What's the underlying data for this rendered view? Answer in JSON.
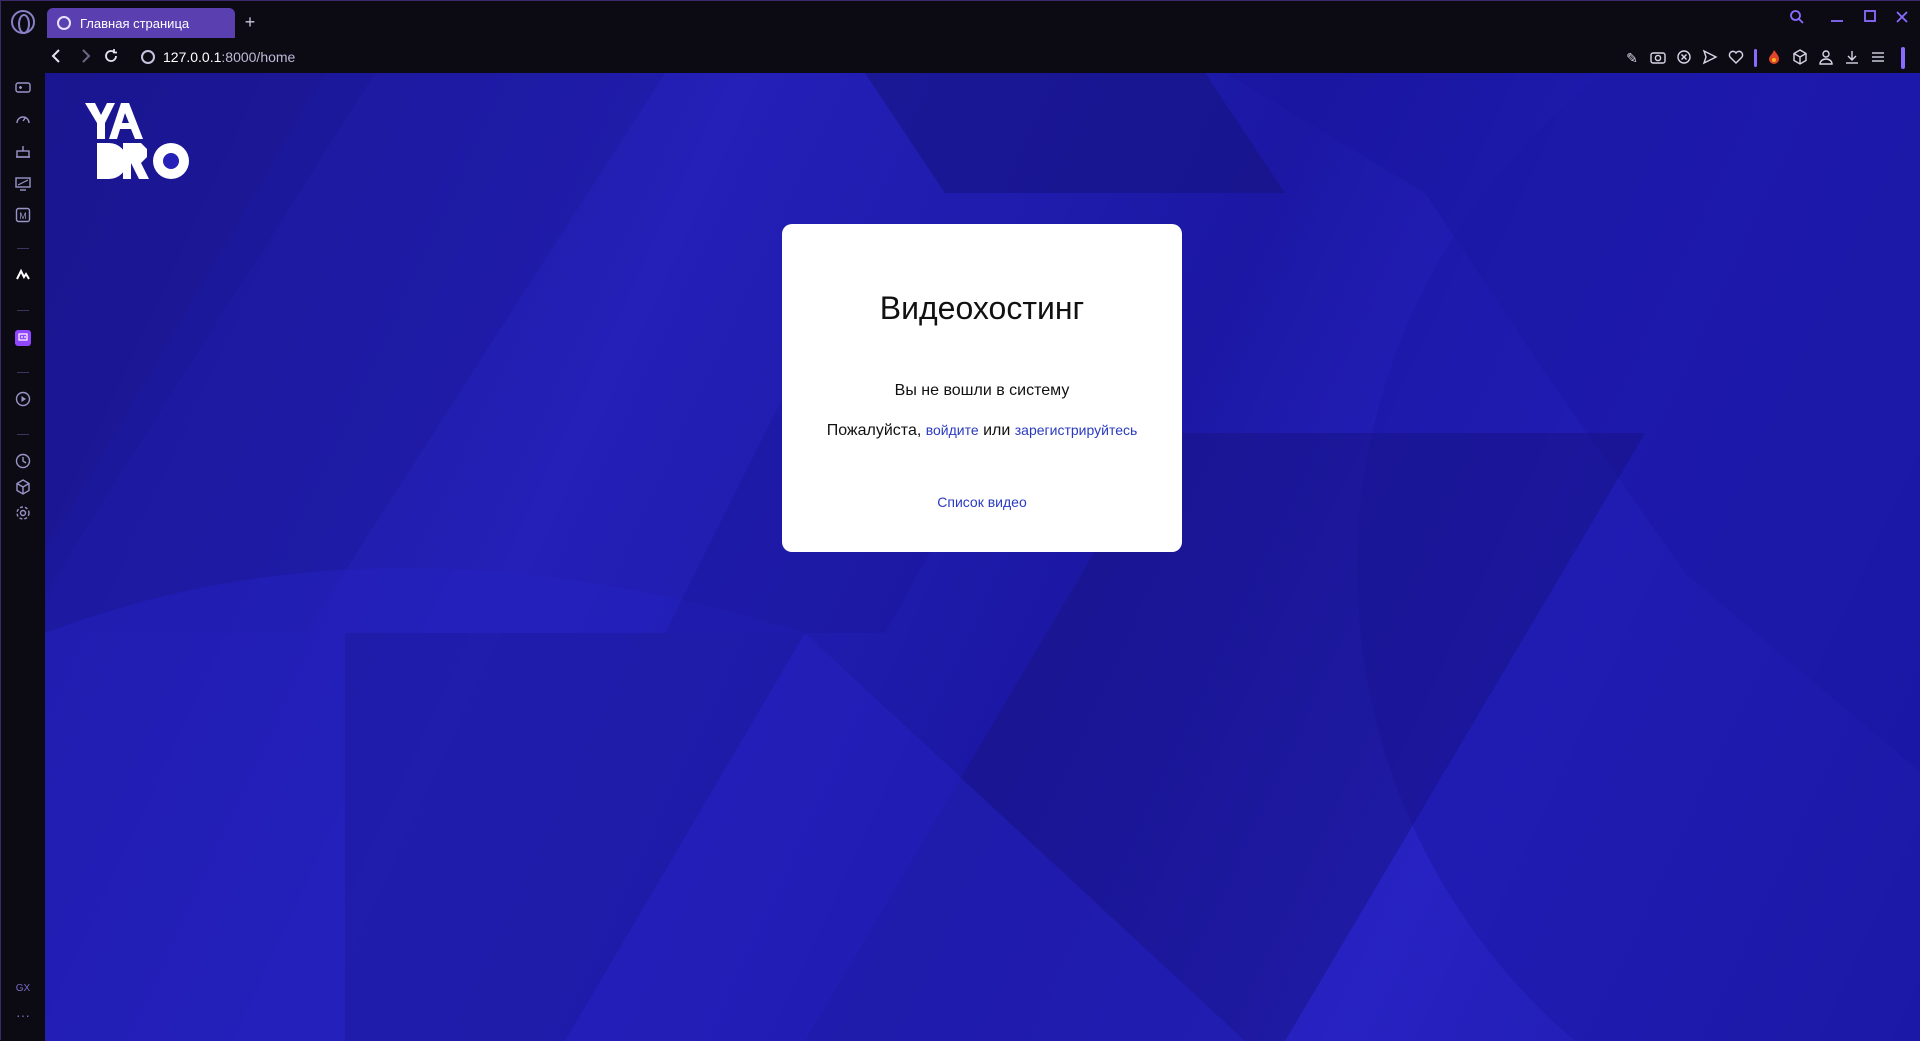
{
  "browser": {
    "tab_title": "Главная страница",
    "new_tab_symbol": "+",
    "url_host": "127.0.0.1",
    "url_path": ":8000/home",
    "window_controls": [
      "search-icon",
      "minimize-icon",
      "maximize-icon",
      "close-icon"
    ],
    "toolbar_icons": [
      "edit-icon",
      "camera-icon",
      "shield-icon",
      "send-icon",
      "heart-icon",
      "fire-icon",
      "cube-icon",
      "user-icon",
      "download-icon",
      "menu-icon"
    ],
    "sidebar_icons": [
      "gamepad-icon",
      "speedometer-icon",
      "cake-icon",
      "monitor-icon",
      "m-badge-icon",
      "vk-icon",
      "twitch-icon",
      "play-icon",
      "history-icon",
      "cube-icon",
      "settings-icon"
    ],
    "sidebar_bottom_label": "GX",
    "sidebar_more": "···",
    "accent_color": "#8a6bff"
  },
  "page": {
    "logo_text": "YADRO",
    "card": {
      "title": "Видеохостинг",
      "status": "Вы не вошли в систему",
      "prompt_prefix": "Пожалуйста, ",
      "login_link": "войдите",
      "or_text": " или ",
      "register_link": "зарегистрируйтесь",
      "video_list_link": "Список видео"
    },
    "background_color": "#2420b8",
    "link_color": "#2a3ac0"
  }
}
